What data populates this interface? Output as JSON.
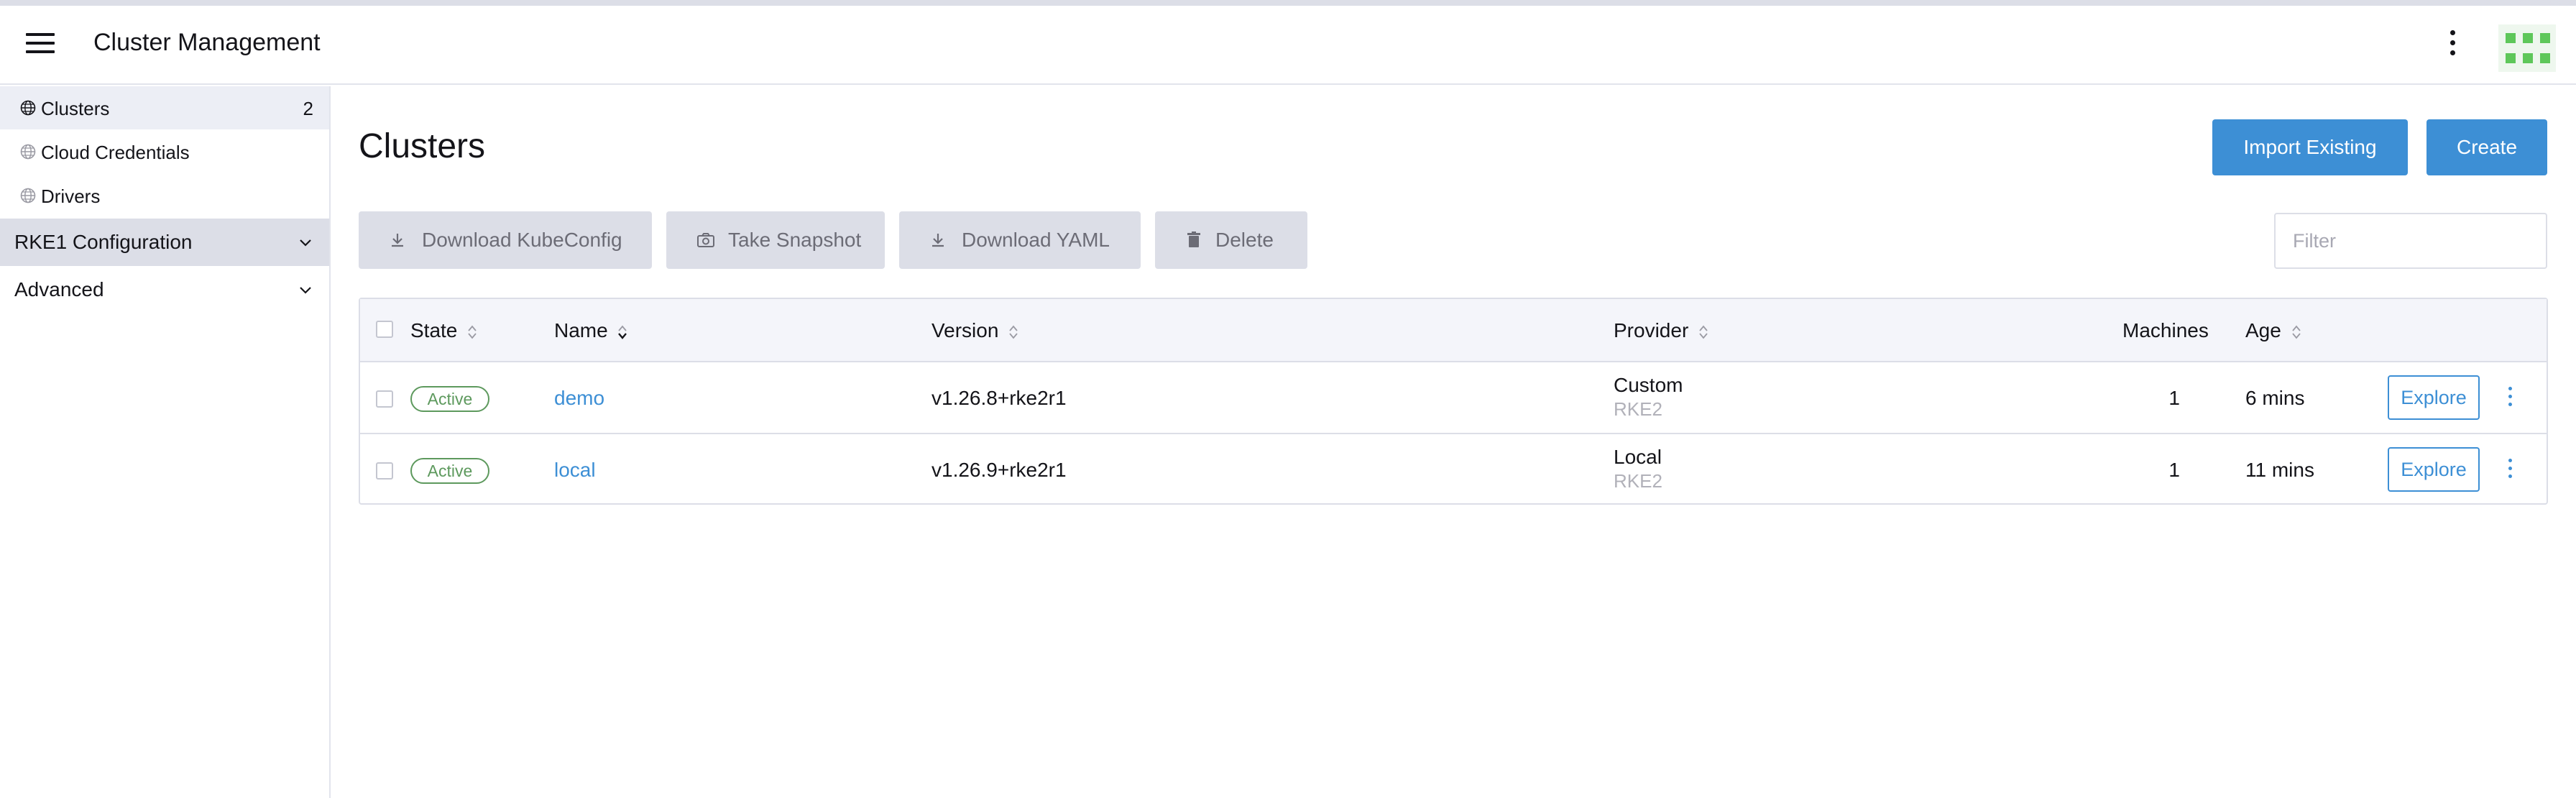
{
  "header": {
    "title": "Cluster Management",
    "menu_icon": "hamburger-icon",
    "more_icon": "kebab-vertical-icon",
    "avatar_icon": "user-avatar-icon"
  },
  "sidebar": {
    "items": [
      {
        "label": "Clusters",
        "count": "2",
        "icon": "globe-icon",
        "active": true
      },
      {
        "label": "Cloud Credentials",
        "icon": "globe-icon"
      },
      {
        "label": "Drivers",
        "icon": "globe-icon"
      }
    ],
    "groups": [
      {
        "label": "RKE1 Configuration",
        "icon": "chevron-down-icon"
      },
      {
        "label": "Advanced",
        "icon": "chevron-down-icon"
      }
    ]
  },
  "page": {
    "title": "Clusters",
    "import_label": "Import Existing",
    "create_label": "Create"
  },
  "bulk_actions": {
    "download_kubeconfig": "Download KubeConfig",
    "take_snapshot": "Take Snapshot",
    "download_yaml": "Download YAML",
    "delete": "Delete"
  },
  "filter": {
    "placeholder": "Filter",
    "value": ""
  },
  "table": {
    "columns": [
      "State",
      "Name",
      "Version",
      "Provider",
      "Machines",
      "Age"
    ],
    "rows": [
      {
        "state": "Active",
        "name": "demo",
        "version": "v1.26.8+rke2r1",
        "provider": "Custom",
        "provider_sub": "RKE2",
        "machines": "1",
        "age": "6 mins",
        "action": "Explore"
      },
      {
        "state": "Active",
        "name": "local",
        "version": "v1.26.9+rke2r1",
        "provider": "Local",
        "provider_sub": "RKE2",
        "machines": "1",
        "age": "11 mins",
        "action": "Explore"
      }
    ]
  },
  "colors": {
    "accent": "#3d8fd5",
    "active_badge": "#5d995d",
    "disabled_button": "#dcdee7",
    "sidebar_active": "#eceef5"
  }
}
